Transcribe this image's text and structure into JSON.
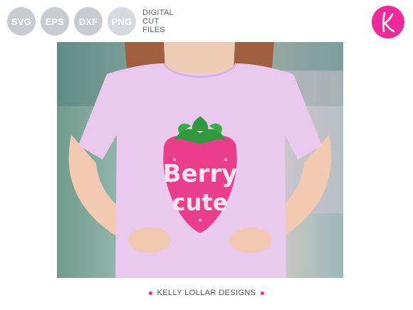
{
  "formats": [
    "SVG",
    "EPS",
    "DXF",
    "PNG"
  ],
  "cut_files_label": [
    "DIGITAL",
    "CUT",
    "FILES"
  ],
  "logo": {
    "letter": "K",
    "color": "#ee2a9b"
  },
  "shirt_text": {
    "line1": "Berry",
    "line2": "cute"
  },
  "colors": {
    "badge": "#c7ccd1",
    "accent": "#ee2a9b",
    "shirt": "#e9c9ee",
    "strawberry": "#ea3d8c",
    "leaves": "#2f9a3b"
  },
  "footer": {
    "text": "KELLY LOLLAR DESIGNS"
  }
}
